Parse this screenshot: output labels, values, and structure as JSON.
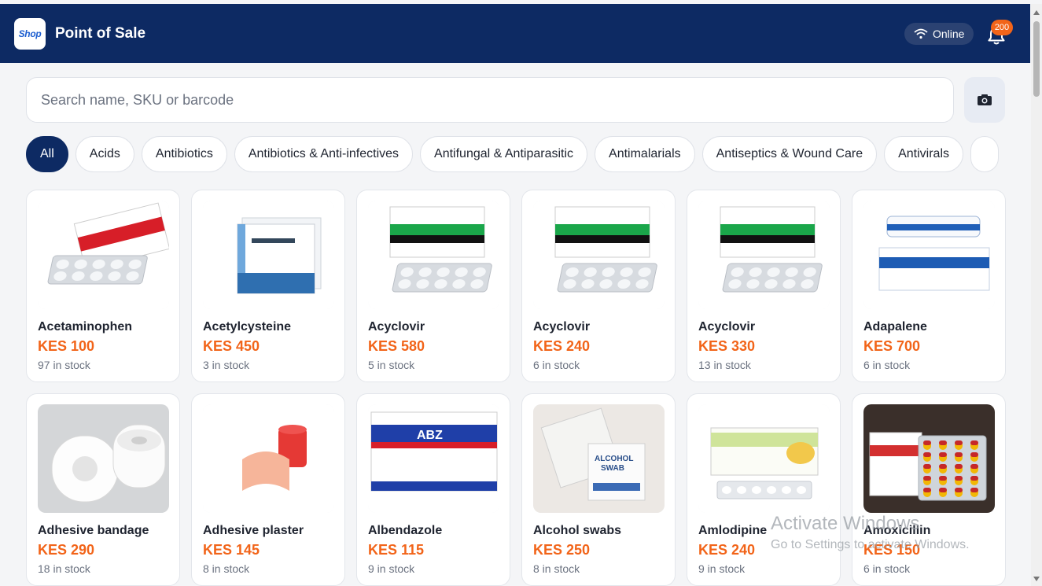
{
  "header": {
    "logo_text": "Shop",
    "title": "Point of Sale",
    "status": "Online",
    "notification_count": "200"
  },
  "search": {
    "placeholder": "Search name, SKU or barcode"
  },
  "categories": [
    {
      "label": "All",
      "active": true
    },
    {
      "label": "Acids"
    },
    {
      "label": "Antibiotics"
    },
    {
      "label": "Antibiotics & Anti-infectives"
    },
    {
      "label": "Antifungal & Antiparasitic"
    },
    {
      "label": "Antimalarials"
    },
    {
      "label": "Antiseptics & Wound Care"
    },
    {
      "label": "Antivirals"
    },
    {
      "label": ""
    }
  ],
  "products": [
    {
      "name": "Acetaminophen",
      "price": "KES 100",
      "stock": "97 in stock",
      "art": "box-red"
    },
    {
      "name": "Acetylcysteine",
      "price": "KES 450",
      "stock": "3 in stock",
      "art": "box-blue"
    },
    {
      "name": "Acyclovir",
      "price": "KES 580",
      "stock": "5 in stock",
      "art": "box-green"
    },
    {
      "name": "Acyclovir",
      "price": "KES 240",
      "stock": "6 in stock",
      "art": "box-green"
    },
    {
      "name": "Acyclovir",
      "price": "KES 330",
      "stock": "13 in stock",
      "art": "box-green"
    },
    {
      "name": "Adapalene",
      "price": "KES 700",
      "stock": "6 in stock",
      "art": "tube-blue"
    },
    {
      "name": "Adhesive bandage",
      "price": "KES 290",
      "stock": "18 in stock",
      "art": "rolls"
    },
    {
      "name": "Adhesive plaster",
      "price": "KES 145",
      "stock": "8 in stock",
      "art": "plaster"
    },
    {
      "name": "Albendazole",
      "price": "KES 115",
      "stock": "9 in stock",
      "art": "box-abz"
    },
    {
      "name": "Alcohol swabs",
      "price": "KES 250",
      "stock": "8 in stock",
      "art": "swabs"
    },
    {
      "name": "Amlodipine",
      "price": "KES 240",
      "stock": "9 in stock",
      "art": "box-teva"
    },
    {
      "name": "Amoxicillin",
      "price": "KES 150",
      "stock": "6 in stock",
      "art": "capsules"
    }
  ],
  "watermark": {
    "line1": "Activate Windows",
    "line2": "Go to Settings to activate Windows."
  },
  "colors": {
    "header": "#0d2a63",
    "accent": "#f26419"
  },
  "icons": [
    "wifi-icon",
    "bell-icon",
    "camera-icon"
  ]
}
